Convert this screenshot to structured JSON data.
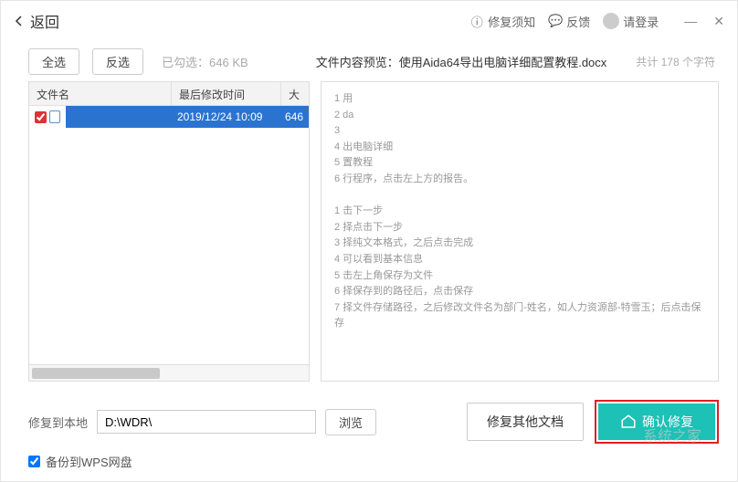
{
  "titlebar": {
    "back_label": "返回",
    "repair_notice": "修复须知",
    "feedback": "反馈",
    "login": "请登录"
  },
  "toolbar": {
    "select_all": "全选",
    "invert_select": "反选",
    "selected_info": "已勾选：646 KB",
    "preview_label": "文件内容预览：使用Aida64导出电脑详细配置教程.docx",
    "char_count": "共计 178 个字符"
  },
  "file_table": {
    "columns": {
      "name": "文件名",
      "mtime": "最后修改时间",
      "size": "大"
    },
    "rows": [
      {
        "checked": true,
        "name": "",
        "mtime": "2019/12/24 10:09",
        "size": "646"
      }
    ]
  },
  "preview_lines": [
    "1 用",
    "2 da",
    "3",
    "4 出电脑详细",
    "5 置教程",
    "6 行程序，点击左上方的报告。",
    "",
    "1 击下一步",
    "2 择点击下一步",
    "3 择纯文本格式，之后点击完成",
    "4 可以看到基本信息",
    "5 击左上角保存为文件",
    "6 择保存到的路径后，点击保存",
    "7 择文件存储路径，之后修改文件名为部门-姓名，如人力资源部-特雪玉；后点击保存"
  ],
  "bottom": {
    "path_label": "修复到本地",
    "path_value": "D:\\WDR\\",
    "browse": "浏览",
    "repair_other": "修复其他文档",
    "confirm": "确认修复",
    "backup_label": "备份到WPS网盘",
    "backup_checked": true
  },
  "watermark": "系统之家"
}
